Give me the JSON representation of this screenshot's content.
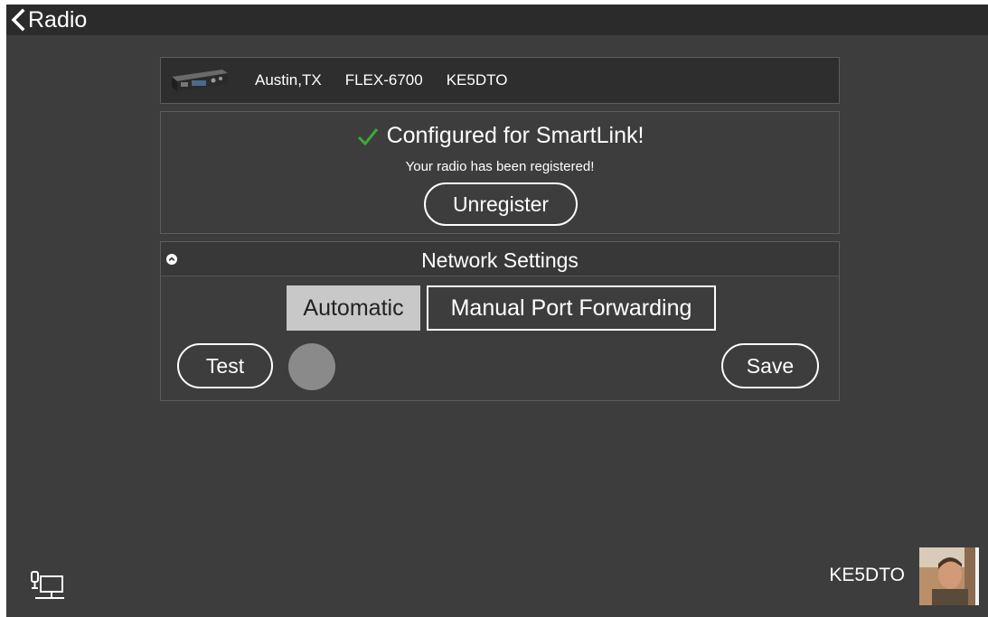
{
  "header": {
    "back_label": "Radio"
  },
  "radio": {
    "location": "Austin,TX",
    "model": "FLEX-6700",
    "callsign": "KE5DTO"
  },
  "smartlink": {
    "title": "Configured for SmartLink!",
    "subtitle": "Your radio has been registered!",
    "unregister_label": "Unregister",
    "check_color": "#3aaa35"
  },
  "network": {
    "title": "Network Settings",
    "modes": [
      "Automatic",
      "Manual Port Forwarding"
    ],
    "selected_mode": "Automatic",
    "test_label": "Test",
    "save_label": "Save",
    "test_status_color": "#8a8a8a"
  },
  "footer": {
    "user_callsign": "KE5DTO"
  },
  "icons": [
    "chevron-left-icon",
    "radio-device-image",
    "checkmark-icon",
    "chevron-up-icon",
    "network-status-icon",
    "user-avatar"
  ]
}
